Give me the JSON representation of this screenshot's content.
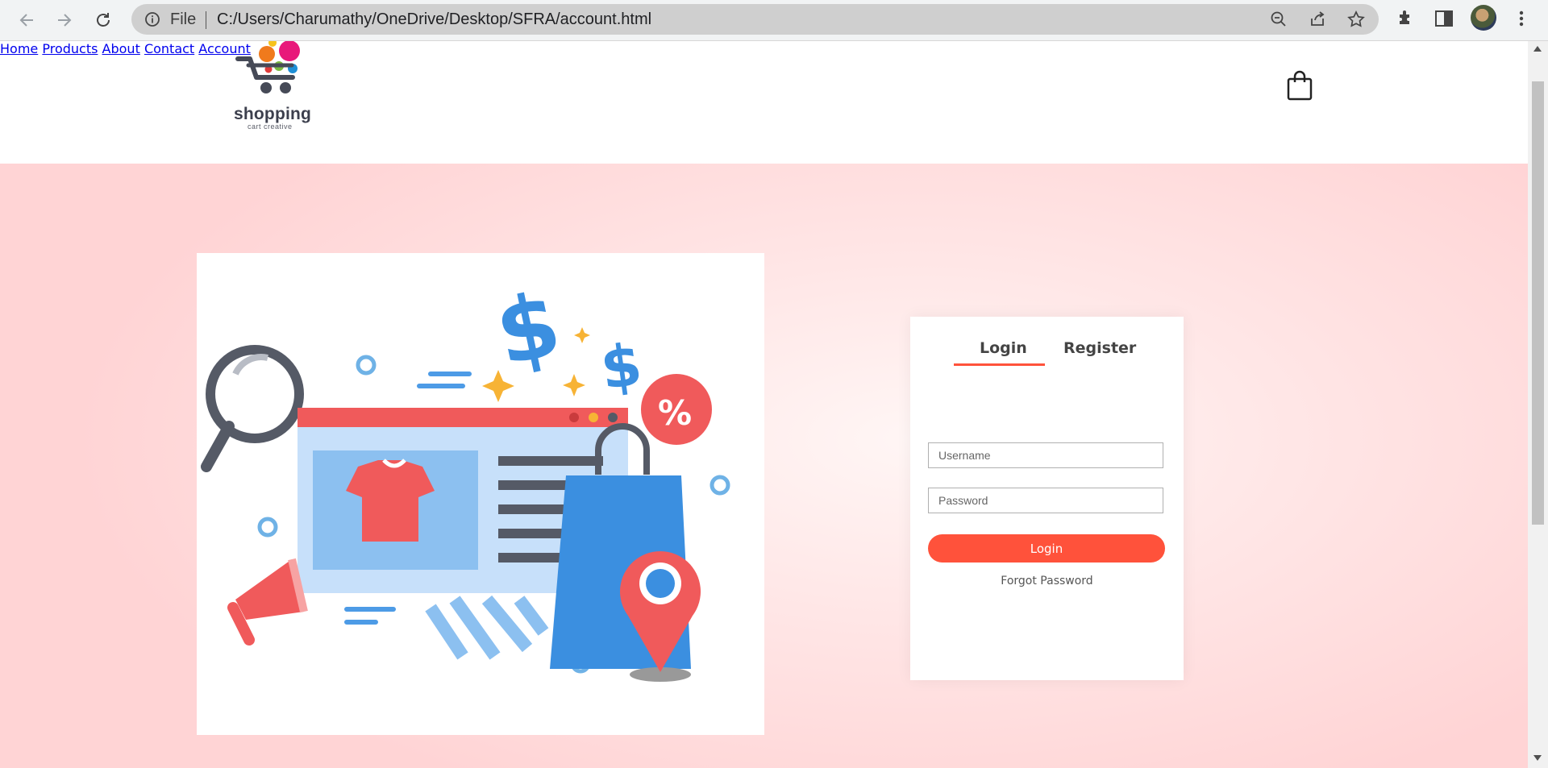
{
  "browser": {
    "scheme_label": "File",
    "url": "C:/Users/Charumathy/OneDrive/Desktop/SFRA/account.html",
    "icons": [
      "back-icon",
      "forward-icon",
      "reload-icon",
      "info-icon",
      "zoom-icon",
      "share-icon",
      "star-icon",
      "extensions-icon",
      "side-panel-icon",
      "profile-avatar",
      "more-icon"
    ]
  },
  "header": {
    "logo_text": "shopping",
    "logo_subtext": "cart creative",
    "menu": [
      {
        "label": "Home"
      },
      {
        "label": "Products"
      },
      {
        "label": "About"
      },
      {
        "label": "Contact"
      },
      {
        "label": "Account"
      }
    ],
    "cart_icon": "shopping-bag-icon"
  },
  "hero": {
    "illustration": "online-shopping-illustration"
  },
  "account_form": {
    "tabs": [
      {
        "label": "Login",
        "active": true
      },
      {
        "label": "Register",
        "active": false
      }
    ],
    "username_placeholder": "Username",
    "password_placeholder": "Password",
    "login_button": "Login",
    "forgot_link": "Forgot Password"
  },
  "colors": {
    "accent": "#ff523b",
    "hero_background": "#ffd9d9",
    "text": "#555555"
  }
}
